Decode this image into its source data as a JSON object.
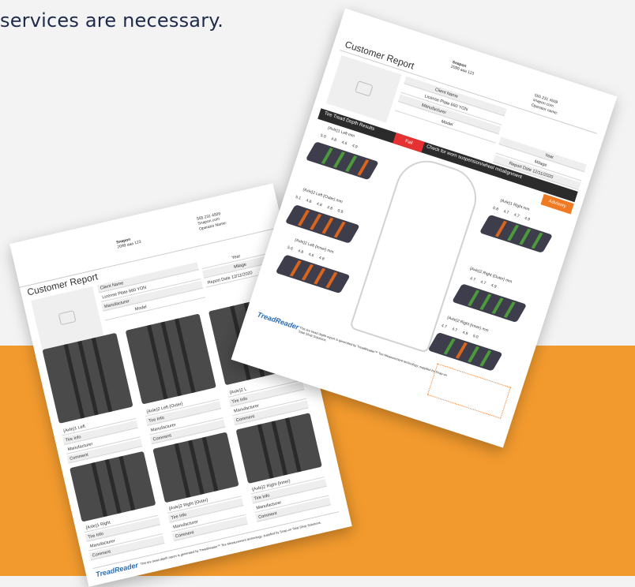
{
  "headline": "services are necessary.",
  "back": {
    "company": "Snapon",
    "address": "2099 aaa 123",
    "phone": "555 231 4509",
    "website": "Snapon.com",
    "operator": "Operator Name:",
    "title": "Customer Report",
    "fields_left": [
      "Client Name",
      "License Plate 660 YON",
      "Manufacturer",
      "Model"
    ],
    "fields_right": [
      "Year",
      "Milage",
      "Report Date 12/11/2020"
    ],
    "tires_top": [
      "{Axle}1 Left",
      "{Axle}2 Left {Outer}",
      "{Axle}2 L"
    ],
    "tire_fields": [
      "Tire Info",
      "Manufacturer",
      "Comment"
    ],
    "tires_bottom": [
      "{Axle}1 Right",
      "{Axle}2 Right {Outer}",
      "{Axle}2 Right {Inner}"
    ],
    "footer_logo": "TreadReader",
    "footer": "This tire tread depth report is generated by TreadReader™ Tire Measurement technology, supplied by Snap-on Total Shop Solutions."
  },
  "front": {
    "company": "Snapon",
    "address": "2099 aaa 123",
    "phone": "555 231 4509",
    "website": "snapon.com",
    "operator": "Operator name:",
    "title": "Customer Report",
    "fields_left": [
      "Client Name",
      "License Plate 660 YON",
      "Manufacturer",
      "Model"
    ],
    "fields_right": [
      "Year",
      "Milage",
      "Report Date 12/11/2020"
    ],
    "bar_label": "Tire Tread Depth Results",
    "fail": "Fail",
    "bar_message": "Check for worn suspension/wheel misalignment",
    "advisory": "Advisory",
    "tires": [
      {
        "label": "{Axle}1 Left mm",
        "values": [
          "5.0",
          "4.8",
          "4.6",
          "4.9"
        ]
      },
      {
        "label": "{Axle}1 Right mm",
        "values": [
          "0.8",
          "4.7",
          "4.7",
          "4.9"
        ]
      },
      {
        "label": "{Axle}2 Left {Outer} mm",
        "values": [
          "5.1",
          "4.8",
          "4.8",
          "4.8",
          "0.9"
        ]
      },
      {
        "label": "{Axle}2 Right {Outer} mm",
        "values": [
          "4.7",
          "4.7",
          "4.9"
        ]
      },
      {
        "label": "{Axle}2 Left {Inner} mm",
        "values": [
          "5.0",
          "4.8",
          "4.6",
          "4.8"
        ]
      },
      {
        "label": "{Axle}2 Right {Inner} mm",
        "values": [
          "4.7",
          "4.7",
          "4.9",
          "5.0"
        ]
      }
    ],
    "footer_logo": "TreadReader",
    "footer": "This tire tread depth report is generated by TreadReader™ Tire Measurement technology, supplied by Snap-on Total Shop Solutions.",
    "colors": {
      "fail": "#e53131",
      "advisory": "#f07a22",
      "bar": "#2b2b2b",
      "green": "#4c9a3c",
      "orange": "#d9641e"
    }
  }
}
